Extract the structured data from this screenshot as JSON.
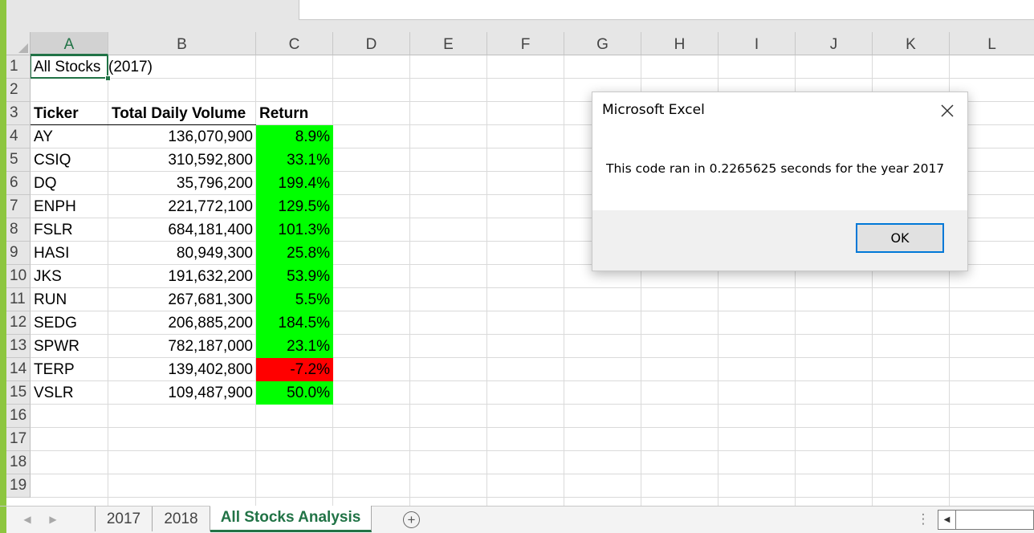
{
  "columns": [
    "A",
    "B",
    "C",
    "D",
    "E",
    "F",
    "G",
    "H",
    "I",
    "J",
    "K",
    "L"
  ],
  "rows": [
    "1",
    "2",
    "3",
    "4",
    "5",
    "6",
    "7",
    "8",
    "9",
    "10",
    "11",
    "12",
    "13",
    "14",
    "15",
    "16",
    "17",
    "18",
    "19"
  ],
  "sheet": {
    "a1": "All Stocks",
    "b1": "(2017)",
    "headers": {
      "ticker": "Ticker",
      "volume": "Total Daily Volume",
      "return": "Return"
    },
    "data": [
      {
        "ticker": "AY",
        "volume": "136,070,900",
        "return": "8.9%",
        "status": "positive"
      },
      {
        "ticker": "CSIQ",
        "volume": "310,592,800",
        "return": "33.1%",
        "status": "positive"
      },
      {
        "ticker": "DQ",
        "volume": "35,796,200",
        "return": "199.4%",
        "status": "positive"
      },
      {
        "ticker": "ENPH",
        "volume": "221,772,100",
        "return": "129.5%",
        "status": "positive"
      },
      {
        "ticker": "FSLR",
        "volume": "684,181,400",
        "return": "101.3%",
        "status": "positive"
      },
      {
        "ticker": "HASI",
        "volume": "80,949,300",
        "return": "25.8%",
        "status": "positive"
      },
      {
        "ticker": "JKS",
        "volume": "191,632,200",
        "return": "53.9%",
        "status": "positive"
      },
      {
        "ticker": "RUN",
        "volume": "267,681,300",
        "return": "5.5%",
        "status": "positive"
      },
      {
        "ticker": "SEDG",
        "volume": "206,885,200",
        "return": "184.5%",
        "status": "positive"
      },
      {
        "ticker": "SPWR",
        "volume": "782,187,000",
        "return": "23.1%",
        "status": "positive"
      },
      {
        "ticker": "TERP",
        "volume": "139,402,800",
        "return": "-7.2%",
        "status": "negative"
      },
      {
        "ticker": "VSLR",
        "volume": "109,487,900",
        "return": "50.0%",
        "status": "positive"
      }
    ]
  },
  "colors": {
    "positive": "#00ff00",
    "negative": "#ff0000",
    "accent": "#217346"
  },
  "dialog": {
    "title": "Microsoft Excel",
    "message": "This code ran in 0.2265625 seconds for the year 2017",
    "ok_label": "OK",
    "close_icon": "close-icon"
  },
  "tabs": [
    {
      "label": "2017",
      "active": false
    },
    {
      "label": "2018",
      "active": false
    },
    {
      "label": "All Stocks Analysis",
      "active": true
    }
  ],
  "icons": {
    "add_sheet": "+",
    "tab_options": "⋮",
    "scroll_left": "◀",
    "nav_prev": "◀",
    "nav_next": "▶"
  }
}
